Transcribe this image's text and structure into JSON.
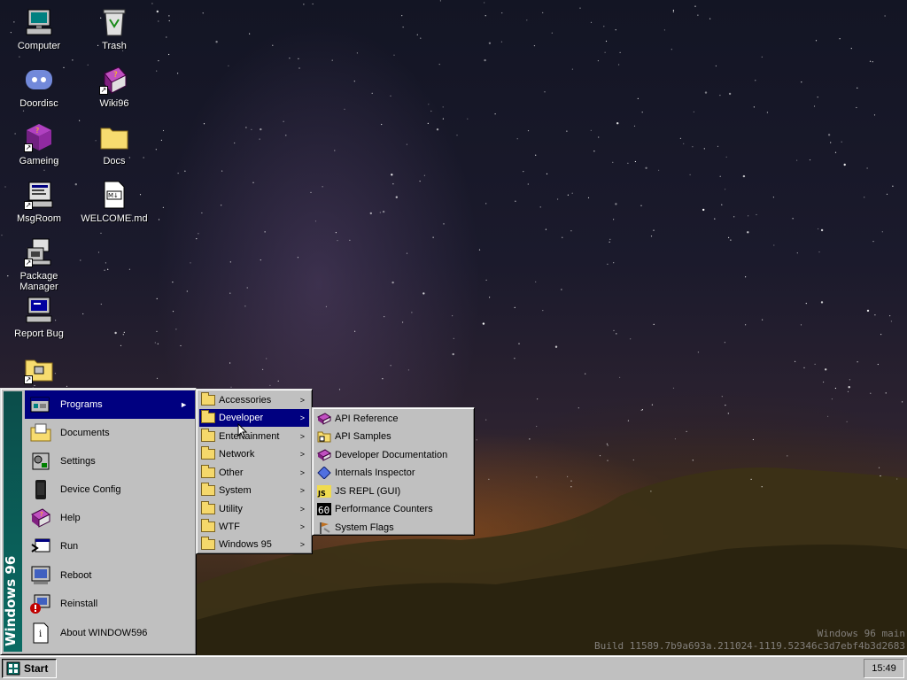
{
  "desktop": {
    "icons": [
      {
        "label": "Computer",
        "icon": "computer-icon"
      },
      {
        "label": "Trash",
        "icon": "trash-icon"
      },
      {
        "label": "Doordisc",
        "icon": "doordisc-icon"
      },
      {
        "label": "Wiki96",
        "icon": "wiki-book-icon"
      },
      {
        "label": "Gameing",
        "icon": "game-cube-icon"
      },
      {
        "label": "Docs",
        "icon": "folder-icon"
      },
      {
        "label": "MsgRoom",
        "icon": "chat-computer-icon"
      },
      {
        "label": "WELCOME.md",
        "icon": "markdown-file-icon"
      },
      {
        "label": "Package Manager",
        "icon": "package-manager-icon"
      },
      {
        "label": "Report Bug",
        "icon": "bug-report-icon"
      }
    ],
    "build_line1": "Windows 96 main",
    "build_line2": "Build 11589.7b9a693a.211024-1119.52346c3d7ebf4b3d2683"
  },
  "start_menu": {
    "banner": "Windows 96",
    "items": [
      {
        "label": "Programs",
        "icon": "programs-icon",
        "has_submenu": true
      },
      {
        "label": "Documents",
        "icon": "documents-folder-icon"
      },
      {
        "label": "Settings",
        "icon": "settings-icon"
      },
      {
        "label": "Device Config",
        "icon": "device-icon"
      },
      {
        "label": "Help",
        "icon": "help-book-icon"
      },
      {
        "label": "Run",
        "icon": "run-icon"
      },
      {
        "label": "Reboot",
        "icon": "reboot-icon"
      },
      {
        "label": "Reinstall",
        "icon": "reinstall-icon"
      },
      {
        "label": "About WINDOW596",
        "icon": "about-icon"
      }
    ]
  },
  "programs_menu": {
    "items": [
      {
        "label": "Accessories"
      },
      {
        "label": "Developer"
      },
      {
        "label": "Entertainment"
      },
      {
        "label": "Network"
      },
      {
        "label": "Other"
      },
      {
        "label": "System"
      },
      {
        "label": "Utility"
      },
      {
        "label": "WTF"
      },
      {
        "label": "Windows 95"
      }
    ]
  },
  "developer_menu": {
    "items": [
      {
        "label": "API Reference",
        "icon": "book-icon"
      },
      {
        "label": "API Samples",
        "icon": "samples-folder-icon"
      },
      {
        "label": "Developer Documentation",
        "icon": "book-icon"
      },
      {
        "label": "Internals Inspector",
        "icon": "diamond-icon"
      },
      {
        "label": "JS REPL (GUI)",
        "icon": "js-icon"
      },
      {
        "label": "Performance Counters",
        "icon": "counter-icon"
      },
      {
        "label": "System Flags",
        "icon": "flags-icon"
      }
    ]
  },
  "taskbar": {
    "start_label": "Start",
    "clock": "15:49"
  },
  "colors": {
    "highlight": "#000080",
    "face": "#c0c0c0",
    "banner": "#0a6b63"
  }
}
